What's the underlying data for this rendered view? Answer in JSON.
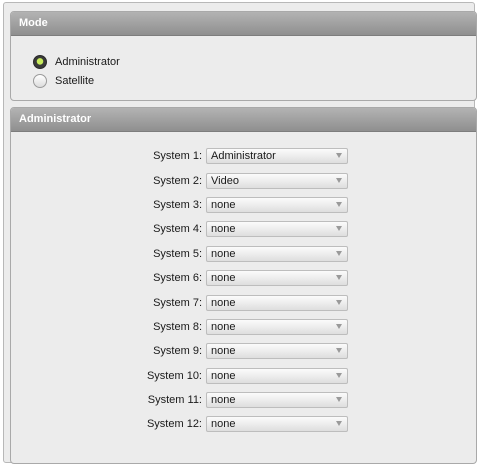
{
  "mode": {
    "header": "Mode",
    "options": [
      {
        "label": "Administrator",
        "checked": true
      },
      {
        "label": "Satellite",
        "checked": false
      }
    ]
  },
  "administrator": {
    "header": "Administrator",
    "systems": [
      {
        "label": "System 1:",
        "value": "Administrator"
      },
      {
        "label": "System 2:",
        "value": "Video"
      },
      {
        "label": "System 3:",
        "value": "none"
      },
      {
        "label": "System 4:",
        "value": "none"
      },
      {
        "label": "System 5:",
        "value": "none"
      },
      {
        "label": "System 6:",
        "value": "none"
      },
      {
        "label": "System 7:",
        "value": "none"
      },
      {
        "label": "System 8:",
        "value": "none"
      },
      {
        "label": "System 9:",
        "value": "none"
      },
      {
        "label": "System 10:",
        "value": "none"
      },
      {
        "label": "System 11:",
        "value": "none"
      },
      {
        "label": "System 12:",
        "value": "none"
      }
    ]
  }
}
